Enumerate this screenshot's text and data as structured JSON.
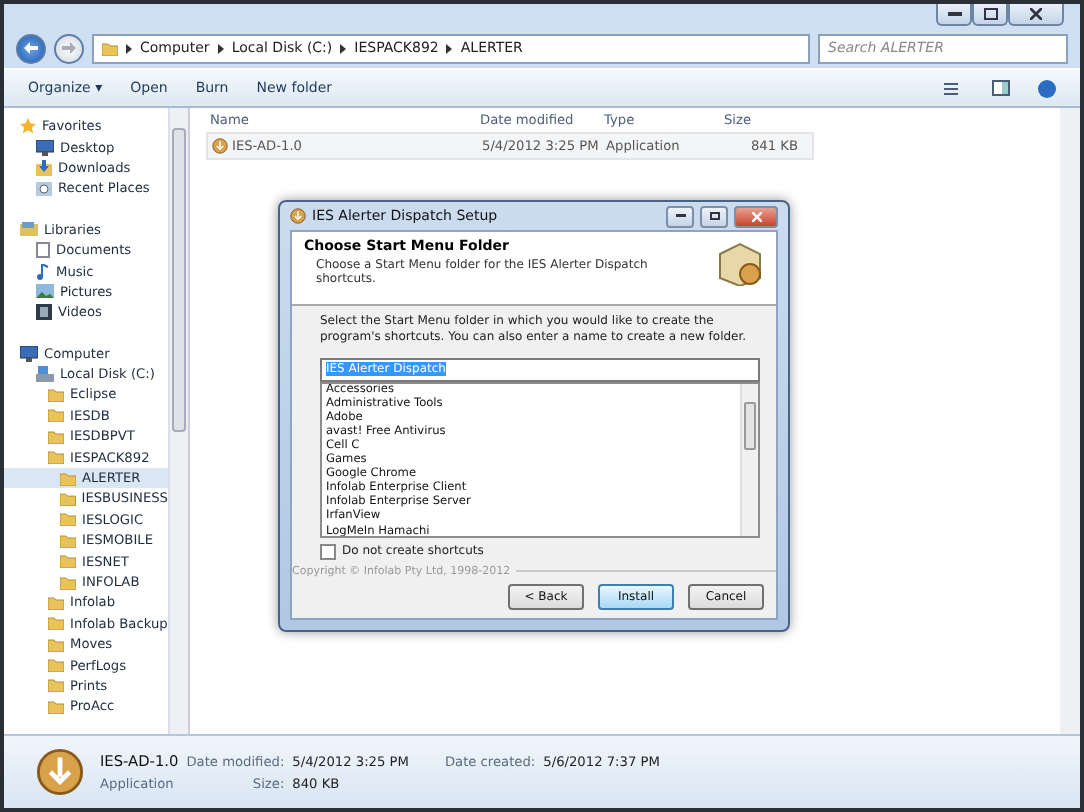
{
  "address_bar": {
    "path": [
      "Computer",
      "Local Disk (C:)",
      "IESPACK892",
      "ALERTER"
    ]
  },
  "search": {
    "placeholder": "Search ALERTER"
  },
  "toolbar": {
    "items": [
      "Organize ▾",
      "Open",
      "Burn",
      "New folder"
    ]
  },
  "sidebar": {
    "sections": [
      {
        "label": "Favorites",
        "kind": "favorites",
        "selected": false,
        "children": [
          {
            "label": "Desktop",
            "kind": "desktop",
            "selected": false
          },
          {
            "label": "Downloads",
            "kind": "downloads",
            "selected": false
          },
          {
            "label": "Recent Places",
            "kind": "recent",
            "selected": false
          }
        ]
      },
      {
        "label": "Libraries",
        "kind": "libraries",
        "selected": false,
        "children": [
          {
            "label": "Documents",
            "kind": "documents",
            "selected": false
          },
          {
            "label": "Music",
            "kind": "music",
            "selected": false
          },
          {
            "label": "Pictures",
            "kind": "pictures",
            "selected": false
          },
          {
            "label": "Videos",
            "kind": "videos",
            "selected": false
          }
        ]
      },
      {
        "label": "Computer",
        "kind": "computer",
        "selected": false,
        "children": [
          {
            "label": "Local Disk (C:)",
            "kind": "drive",
            "selected": false,
            "children": [
              {
                "label": "Eclipse",
                "kind": "folder",
                "selected": false
              },
              {
                "label": "IESDB",
                "kind": "folder",
                "selected": false
              },
              {
                "label": "IESDBPVT",
                "kind": "folder",
                "selected": false
              },
              {
                "label": "IESPACK892",
                "kind": "folder",
                "selected": false,
                "children": [
                  {
                    "label": "ALERTER",
                    "kind": "folder",
                    "selected": true
                  },
                  {
                    "label": "IESBUSINESS",
                    "kind": "folder",
                    "selected": false
                  },
                  {
                    "label": "IESLOGIC",
                    "kind": "folder",
                    "selected": false
                  },
                  {
                    "label": "IESMOBILE",
                    "kind": "folder",
                    "selected": false
                  },
                  {
                    "label": "IESNET",
                    "kind": "folder",
                    "selected": false
                  },
                  {
                    "label": "INFOLAB",
                    "kind": "folder",
                    "selected": false
                  }
                ]
              },
              {
                "label": "Infolab",
                "kind": "folder",
                "selected": false
              },
              {
                "label": "Infolab Backup",
                "kind": "folder",
                "selected": false
              },
              {
                "label": "Moves",
                "kind": "folder",
                "selected": false
              },
              {
                "label": "PerfLogs",
                "kind": "folder",
                "selected": false
              },
              {
                "label": "Prints",
                "kind": "folder",
                "selected": false
              },
              {
                "label": "ProAcc",
                "kind": "folder",
                "selected": false
              }
            ]
          }
        ]
      }
    ]
  },
  "file_list": {
    "columns": [
      "Name",
      "Date modified",
      "Type",
      "Size"
    ],
    "rows": [
      {
        "name": "IES-AD-1.0",
        "date_modified": "5/4/2012 3:25 PM",
        "type": "Application",
        "size": "841 KB",
        "selected": false
      }
    ]
  },
  "dialog": {
    "title": "IES Alerter Dispatch Setup",
    "heading": "Choose Start Menu Folder",
    "subheading": "Choose a Start Menu folder for the IES Alerter Dispatch shortcuts.",
    "instructions": "Select the Start Menu folder in which you would like to create the program's shortcuts. You can also enter a name to create a new folder.",
    "folder_field": {
      "value": "IES Alerter Dispatch"
    },
    "folders": [
      "Accessories",
      "Administrative Tools",
      "Adobe",
      "avast! Free Antivirus",
      "Cell C",
      "Games",
      "Google Chrome",
      "Infolab Enterprise Client",
      "Infolab Enterprise Server",
      "IrfanView",
      "LogMeIn Hamachi"
    ],
    "no_shortcuts": {
      "label": "Do not create shortcuts",
      "checked": false
    },
    "copyright": "Copyright © Infolab Pty Ltd, 1998-2012",
    "buttons": [
      {
        "label": "< Back",
        "default": false
      },
      {
        "label": "Install",
        "default": true
      },
      {
        "label": "Cancel",
        "default": false
      }
    ]
  },
  "details_pane": {
    "name": "IES-AD-1.0",
    "type": "Application",
    "fields": [
      {
        "label": "Date modified:",
        "value": "5/4/2012 3:25 PM"
      },
      {
        "label": "Size:",
        "value": "840 KB"
      },
      {
        "label": "Date created:",
        "value": "5/6/2012 7:37 PM"
      }
    ]
  }
}
